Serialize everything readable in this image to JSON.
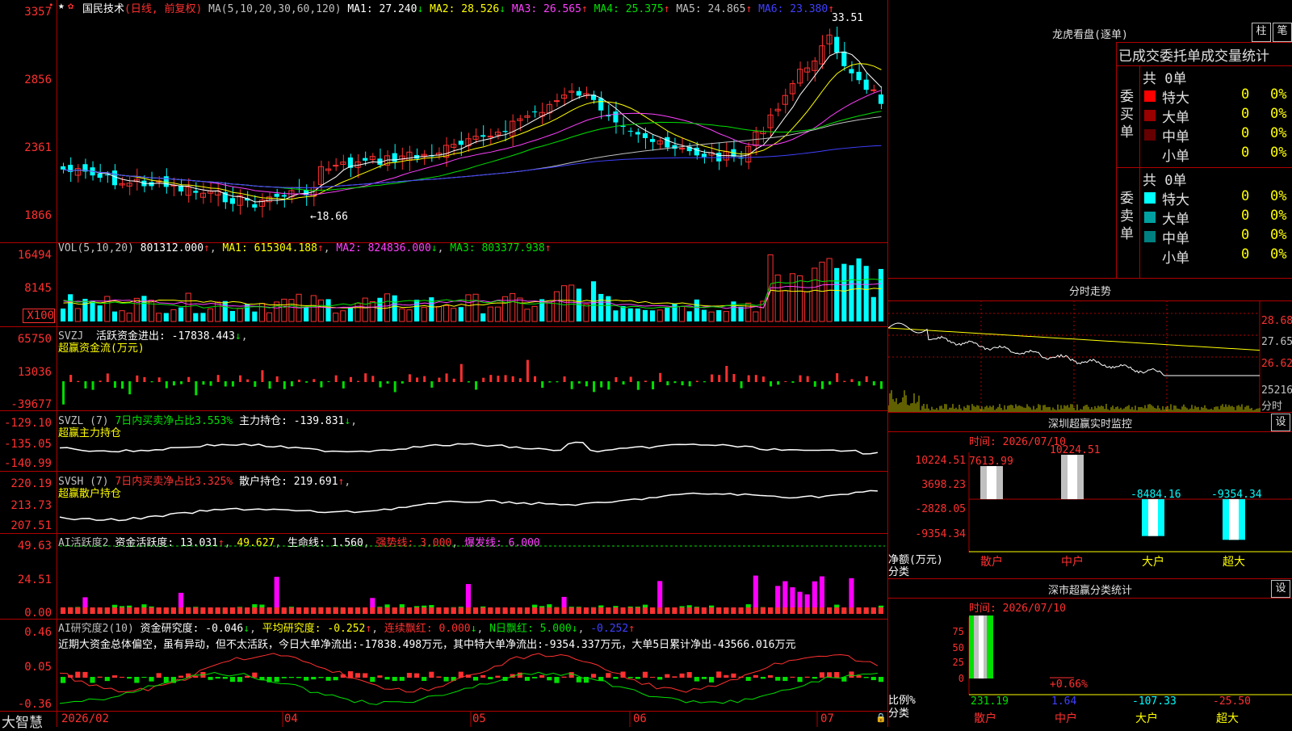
{
  "stock": {
    "name": "国民技术",
    "mode": "(日线, 前复权)",
    "ma_params": "MA(5,10,20,30,60,120)",
    "ma_values": [
      {
        "label": "MA1:",
        "value": "27.240",
        "arrow": "↓",
        "color": "#ffffff"
      },
      {
        "label": "MA2:",
        "value": "28.526",
        "arrow": "↓",
        "color": "#ffff00"
      },
      {
        "label": "MA3:",
        "value": "26.565",
        "arrow": "↑",
        "color": "#ff40ff"
      },
      {
        "label": "MA4:",
        "value": "25.375",
        "arrow": "↑",
        "color": "#00e000"
      },
      {
        "label": "MA5:",
        "value": "24.865",
        "arrow": "↑",
        "color": "#c0c0c0"
      },
      {
        "label": "MA6:",
        "value": "23.380",
        "arrow": "↑",
        "color": "#4040ff"
      }
    ],
    "price_axis": [
      "3357",
      "2856",
      "2361",
      "1866"
    ],
    "high_label": "33.51",
    "low_label": "←18.66"
  },
  "vol": {
    "title": "VOL(5,10,20)",
    "value": "801312.000",
    "ma1": "615304.188",
    "ma2": "824836.000",
    "ma3": "803377.938",
    "axis": [
      "16494",
      "8145",
      "X100"
    ]
  },
  "svzj": {
    "title": "SVZJ",
    "label": "活跃资金进出:",
    "value": "-17838.443",
    "subtitle": "超赢资金流(万元)",
    "axis": [
      "65750",
      "13036",
      "-39677"
    ]
  },
  "svzl": {
    "title": "SVZL (7)",
    "desc": "7日内买卖净占比3.553%",
    "label": "主力持仓:",
    "value": "-139.831",
    "subtitle": "超赢主力持仓",
    "axis": [
      "-129.10",
      "-135.05",
      "-140.99"
    ]
  },
  "svsh": {
    "title": "SVSH (7)",
    "desc": "7日内买卖净占比3.325%",
    "label": "散户持仓:",
    "value": "219.691",
    "subtitle": "超赢散户持仓",
    "axis": [
      "220.19",
      "213.73",
      "207.51"
    ]
  },
  "ai1": {
    "title": "AI活跃度2",
    "label": "资金活跃度:",
    "value": "13.031",
    "v2": "49.627",
    "life": "生命线: 1.560",
    "strong": "强势线: 3.000",
    "burst": "爆发线: 6.000",
    "axis": [
      "49.63",
      "24.51",
      "0.00"
    ]
  },
  "ai2": {
    "title": "AI研究度2(10)",
    "label": "资金研究度:",
    "value": "-0.046",
    "avg": "平均研究度: -0.252",
    "cont": "连续飘红: 0.000",
    "nday": "N日飘红: 5.000",
    "last": "-0.252",
    "comment": "近期大资金总体偏空，虽有异动，但不太活跃，今日大单净流出:-17838.498万元，其中特大单净流出:-9354.337万元，大单5日累计净出-43566.016万元",
    "axis": [
      "0.46",
      "0.05",
      "-0.36"
    ]
  },
  "time_axis": [
    "2026/02",
    "04",
    "05",
    "06",
    "07"
  ],
  "brand": "大智慧",
  "right": {
    "lhb_title": "龙虎看盘(逐单)",
    "btn1": "柱",
    "btn2": "笔",
    "subtitle": "已成交委托单成交量统计",
    "buy_label": "委买单",
    "sell_label": "委卖单",
    "buy_total": "共 0单",
    "sell_total": "共 0单",
    "buy_rows": [
      {
        "name": "特大",
        "count": "0",
        "pct": "0%",
        "color": "#ff0000"
      },
      {
        "name": "大单",
        "count": "0",
        "pct": "0%",
        "color": "#990000"
      },
      {
        "name": "中单",
        "count": "0",
        "pct": "0%",
        "color": "#660000"
      },
      {
        "name": "小单",
        "count": "0",
        "pct": "0%",
        "color": "#000000"
      }
    ],
    "sell_rows": [
      {
        "name": "特大",
        "count": "0",
        "pct": "0%",
        "color": "#00ffff"
      },
      {
        "name": "大单",
        "count": "0",
        "pct": "0%",
        "color": "#00a0a0"
      },
      {
        "name": "中单",
        "count": "0",
        "pct": "0%",
        "color": "#008080"
      },
      {
        "name": "小单",
        "count": "0",
        "pct": "0%",
        "color": "#000000"
      }
    ],
    "minute_title": "分时走势",
    "minute_axis": [
      "28.68",
      "27.65",
      "26.62",
      "25216"
    ],
    "minute_unit": "分时",
    "sz_title": "深圳超赢实时监控",
    "sz_btn": "设",
    "sz_time": "时间: 2026/07/10",
    "sz_axis": [
      "10224.51",
      "3698.23",
      "-2828.05",
      "-9354.34"
    ],
    "sz_unit": "净额(万元)",
    "sz_unit2": "分类",
    "sz_bars": [
      {
        "name": "散户",
        "value": 7613.99,
        "label": "7613.99"
      },
      {
        "name": "中户",
        "value": 10224.51,
        "label": "10224.51"
      },
      {
        "name": "大户",
        "value": -8484.16,
        "label": "-8484.16"
      },
      {
        "name": "超大",
        "value": -9354.34,
        "label": "-9354.34"
      }
    ],
    "cls_title": "深市超赢分类统计",
    "cls_btn": "设",
    "cls_time": "时间: 2026/07/10",
    "cls_axis": [
      "75",
      "50",
      "25",
      "0"
    ],
    "cls_unit": "比例%",
    "cls_unit2": "分类",
    "cls_pct": "+0.66%",
    "cls_bars": [
      {
        "name": "散户",
        "value": "231.19",
        "color": "#00e000"
      },
      {
        "name": "中户",
        "value": "1.64",
        "color": "#4040ff"
      },
      {
        "name": "大户",
        "value": "-107.33",
        "color": "#00ffff"
      },
      {
        "name": "超大",
        "value": "-25.50",
        "color": "#ff3030"
      }
    ]
  }
}
